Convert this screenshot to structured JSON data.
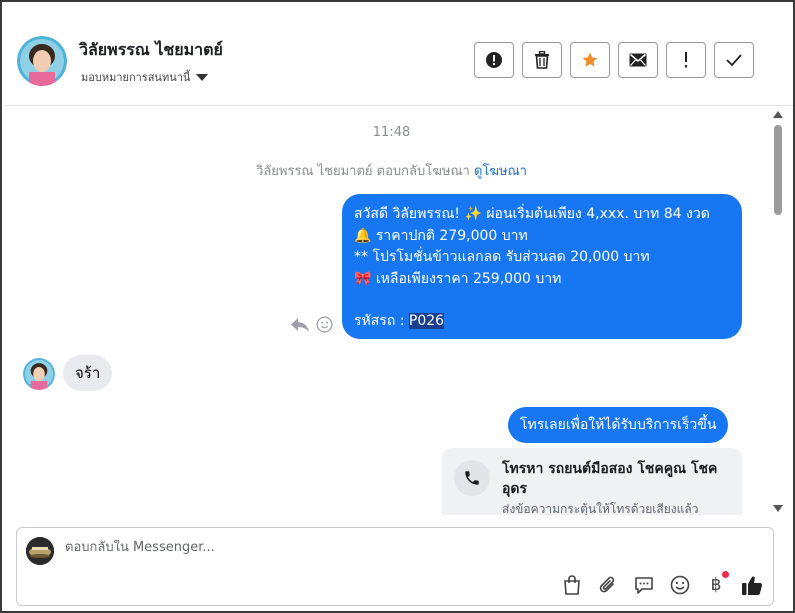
{
  "header": {
    "user_name": "วิลัยพรรณ ไชยมาตย์",
    "assign_label": "มอบหมายการสนทนานี้"
  },
  "conversation": {
    "timestamp": "11:48",
    "notice_text": "วิลัยพรรณ ไชยมาตย์ ตอบกลับโฆษณา",
    "notice_link": "ดูโฆษณา",
    "outgoing_message": {
      "line1": "สวัสดี วิลัยพรรณ! ✨  ผ่อนเริ่มต้นเพียง 4,xxx. บาท 84 งวด",
      "line2": "🔔 ราคาปกติ 279,000 บาท",
      "line3": "** โปรโมชั่นข้าวแลกลด รับส่วนลด 20,000 บาท",
      "line4": "🎀  เหลือเพียงราคา 259,000 บาท",
      "code_label": "รหัสรถ :",
      "code_value": "P026"
    },
    "incoming_message": "จร้า",
    "outgoing_message_2": "โทรเลยเพื่อให้ได้รับบริการเร็วขึ้น",
    "cta_card": {
      "title": "โทรหา รถยนต์มือสอง โชคคูณ โชค อุดร",
      "subtitle": "ส่งข้อความกระตุ้นให้โทรด้วยเสียงแล้ว"
    }
  },
  "composer": {
    "placeholder": "ตอบกลับใน Messenger...",
    "value": ""
  },
  "colors": {
    "accent_blue": "#1777f2",
    "star_orange": "#f28c28",
    "incoming_bg": "#e9eaed"
  }
}
